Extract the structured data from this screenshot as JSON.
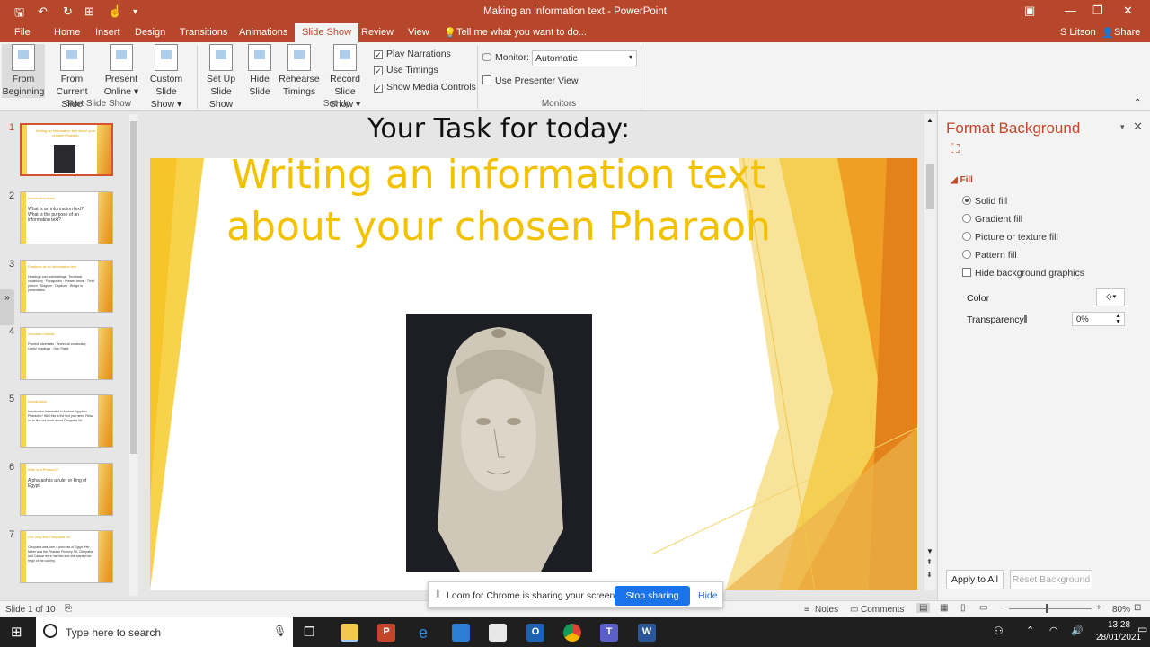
{
  "window": {
    "title": "Making an information text - PowerPoint",
    "accent": "#b7472a"
  },
  "tabs": [
    "File",
    "Home",
    "Insert",
    "Design",
    "Transitions",
    "Animations",
    "Slide Show",
    "Review",
    "View"
  ],
  "active_tab": "Slide Show",
  "tell_me": "Tell me what you want to do...",
  "user": "S Litson",
  "share": "Share",
  "ribbon": {
    "from_beginning": [
      "From",
      "Beginning"
    ],
    "from_current": [
      "From",
      "Current Slide"
    ],
    "present_online": [
      "Present",
      "Online ▾"
    ],
    "custom_show": [
      "Custom Slide",
      "Show ▾"
    ],
    "setup_show": [
      "Set Up",
      "Slide Show"
    ],
    "hide_slide": [
      "Hide",
      "Slide"
    ],
    "rehearse": [
      "Rehearse",
      "Timings"
    ],
    "record": [
      "Record Slide",
      "Show ▾"
    ],
    "play_narrations": "Play Narrations",
    "use_timings": "Use Timings",
    "show_media": "Show Media Controls",
    "group_start": "Start Slide Show",
    "group_setup": "Set Up",
    "monitor_label": "Monitor:",
    "monitor_value": "Automatic",
    "presenter_view": "Use Presenter View",
    "group_monitors": "Monitors"
  },
  "thumbnails": [
    {
      "num": "1",
      "title": "Writing an information text about your chosen Pharaoh",
      "text": ""
    },
    {
      "num": "2",
      "title": "Information texts",
      "text": "What is an information text? What is the purpose of an information text?"
    },
    {
      "num": "3",
      "title": "Features of an information text",
      "text": "Headings and subheadings · Technical vocabulary · Paragraphs · Present tense · Third person · Diagram · Captions · Bridge to presentation"
    },
    {
      "num": "4",
      "title": "Success Criteria",
      "text": "Fronted adverbials · Technical vocabulary · Useful headings · Own Sheet"
    },
    {
      "num": "5",
      "title": "Introduction",
      "text": "Introduction  Interested in Ancient Egyptian Pharaohs? Well this is the text you need! Read on to find out more about Cleopatra VII."
    },
    {
      "num": "6",
      "title": "Who is a Pharaoh?",
      "text": "A pharaoh is a ruler or king of Egypt."
    },
    {
      "num": "7",
      "title": "Our very first Cleopatra VII",
      "text": "Cleopatra was born a princess of Egypt. Her father was the Pharaoh Ptolemy XII. Cleopatra and Caesar were married and she started her reign of the country."
    }
  ],
  "slide": {
    "title": "Your Task for today:",
    "heading": "Writing an information text about your chosen Pharaoh"
  },
  "format_pane": {
    "title": "Format Background",
    "section": "Fill",
    "options": [
      "Solid fill",
      "Gradient fill",
      "Picture or texture fill",
      "Pattern fill"
    ],
    "selected_option": "Solid fill",
    "hide_graphics": "Hide background graphics",
    "color_label": "Color",
    "transparency_label": "Transparency",
    "transparency_value": "0%",
    "apply_all": "Apply to All",
    "reset": "Reset Background"
  },
  "status": {
    "slide_info": "Slide 1 of 10",
    "notes": "Notes",
    "comments": "Comments",
    "zoom": "80%"
  },
  "loom": {
    "message": "Loom for Chrome is sharing your screen.",
    "stop": "Stop sharing",
    "hide": "Hide"
  },
  "taskbar": {
    "search_placeholder": "Type here to search",
    "time": "13:28",
    "date": "28/01/2021"
  }
}
